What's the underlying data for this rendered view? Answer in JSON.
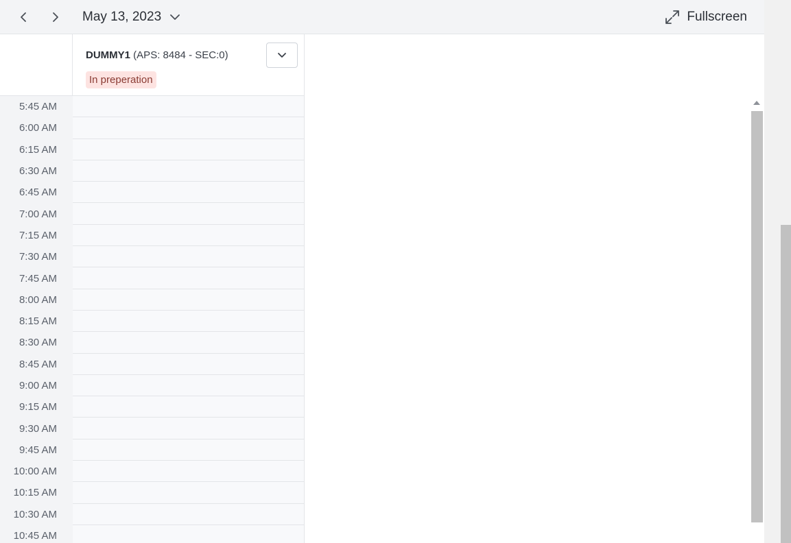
{
  "toolbar": {
    "prev_icon": "chevron-left-icon",
    "next_icon": "chevron-right-icon",
    "date": "May 13, 2023",
    "fullscreen_label": "Fullscreen"
  },
  "resource": {
    "name": "DUMMY1",
    "details": " (APS: 8484 - SEC:0)",
    "status": "In preperation",
    "status_bg": "#fde3e1",
    "status_color": "#8a3b33"
  },
  "time_slots": [
    "5:45 AM",
    "6:00 AM",
    "6:15 AM",
    "6:30 AM",
    "6:45 AM",
    "7:00 AM",
    "7:15 AM",
    "7:30 AM",
    "7:45 AM",
    "8:00 AM",
    "8:15 AM",
    "8:30 AM",
    "8:45 AM",
    "9:00 AM",
    "9:15 AM",
    "9:30 AM",
    "9:45 AM",
    "10:00 AM",
    "10:15 AM",
    "10:30 AM",
    "10:45 AM"
  ]
}
